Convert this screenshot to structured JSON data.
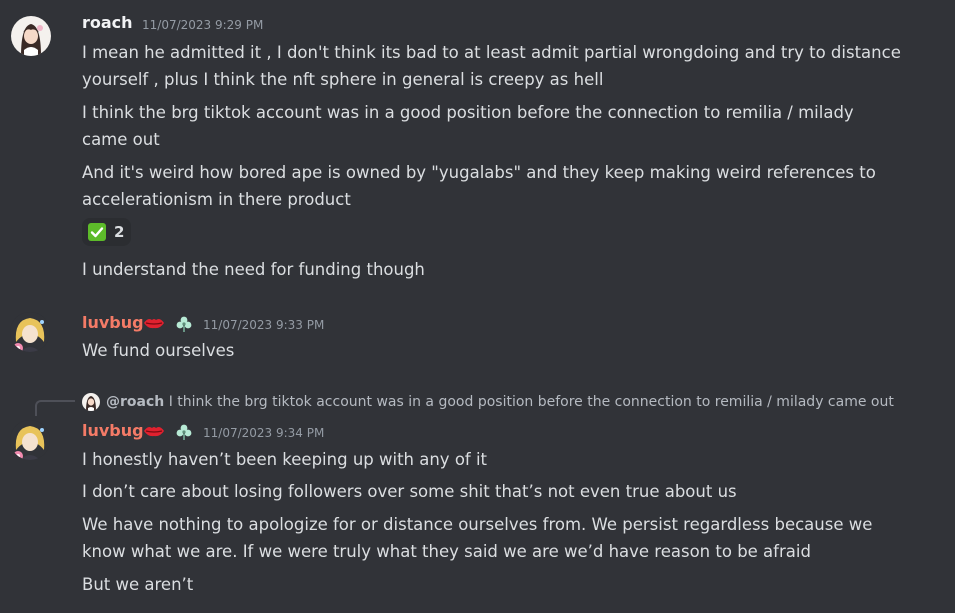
{
  "colors": {
    "background": "#313338",
    "text": "#dbdee1",
    "timestamp": "#949ba4",
    "roach_name": "#f2f3f5",
    "luvbug_name": "#f47b67",
    "reaction_check": "#5dbb2a"
  },
  "messages": [
    {
      "username": "roach",
      "timestamp": "11/07/2023 9:29 PM",
      "lines": [
        [
          "I mean he admitted it , I don't think its bad to at least admit partial wrongdoing and try to distance",
          "yourself , plus I think the nft sphere in general is creepy as hell"
        ],
        [
          "I think the brg tiktok account was in a good position before the connection to remilia / milady",
          "came out"
        ],
        [
          "And it's weird how bored ape is owned by \"yugalabs\" and they keep making weird references to",
          "accelerationism in there product"
        ]
      ],
      "reaction": {
        "emoji": "white-check-mark",
        "count": "2"
      },
      "after_reaction": "I understand the need for funding though"
    },
    {
      "username": "luvbug",
      "badge": "red-lips-icon",
      "role_icon": "green-clover-icon",
      "timestamp": "11/07/2023 9:33 PM",
      "text": "We fund ourselves"
    },
    {
      "reply": {
        "user": "@roach",
        "text": "I think the brg tiktok account was in a good position before the connection to remilia / milady came out"
      },
      "username": "luvbug",
      "badge": "red-lips-icon",
      "role_icon": "green-clover-icon",
      "timestamp": "11/07/2023 9:34 PM",
      "lines": [
        "I honestly haven’t been keeping up with any of it",
        "I don’t care about losing followers over some shit that’s not even true about us",
        "We have nothing to apologize for or distance ourselves from. We persist regardless because we",
        "know what we are. If we were truly what they said we are we’d have reason to be afraid",
        "But we aren’t"
      ]
    }
  ]
}
